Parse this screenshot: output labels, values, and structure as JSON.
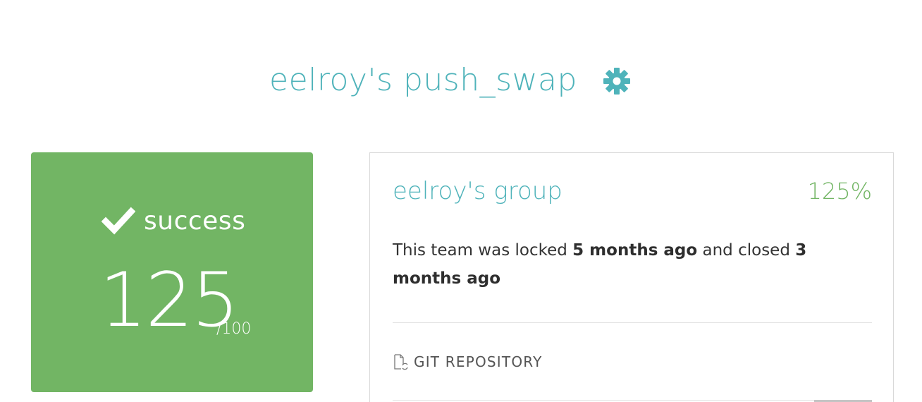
{
  "header": {
    "title": "eelroy's push_swap",
    "settings_icon": "gear-icon"
  },
  "score_card": {
    "status": "success",
    "status_icon": "check-icon",
    "score": "125",
    "max": "/100",
    "background": "#72b564"
  },
  "team": {
    "name": "eelroy's group",
    "percent": "125%",
    "status_prefix": "This team was locked",
    "locked_ago": "5 months ago",
    "status_middle": "and closed",
    "closed_ago": "3 months ago",
    "repo_label": "GIT REPOSITORY",
    "repo_icon": "file-sync-icon"
  },
  "colors": {
    "accent": "#4fb3ba",
    "success": "#72b564",
    "text": "#333333"
  }
}
